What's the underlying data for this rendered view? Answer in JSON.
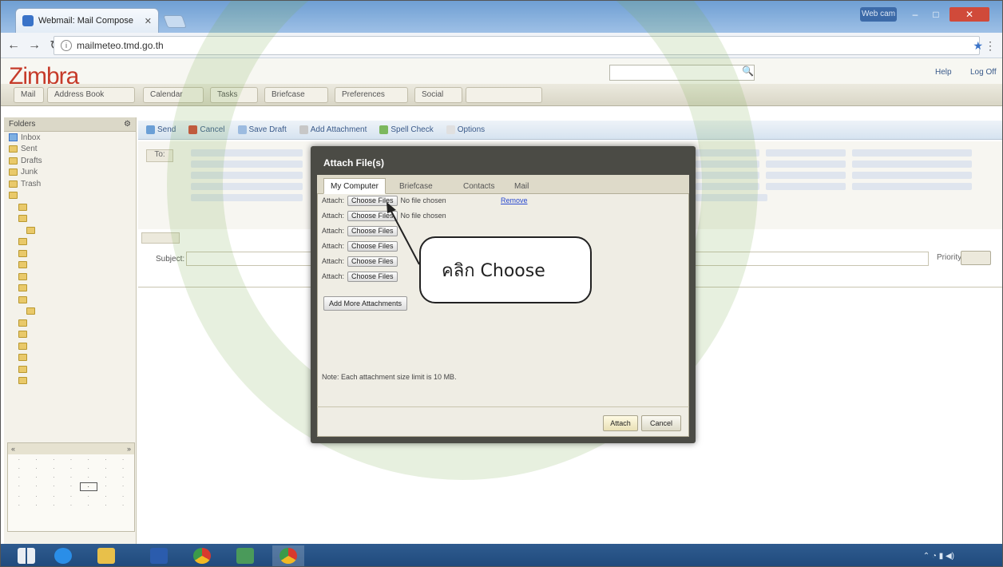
{
  "browser": {
    "tab_title": "Webmail: Mail Compose",
    "url": "mailmeteo.tmd.go.th",
    "user_badge": "Web cam"
  },
  "zimbra": {
    "logo": "Zimbra",
    "search_placeholder": "",
    "user_email": "",
    "help_label": "Help",
    "logoff_label": "Log Off",
    "app_tabs": [
      "Mail",
      "Address Book",
      "Calendar",
      "Tasks",
      "Briefcase",
      "Preferences",
      "Social",
      ""
    ]
  },
  "sidebar": {
    "header": "Folders",
    "folders": [
      {
        "label": "Inbox",
        "level": 0,
        "type": "inbox"
      },
      {
        "label": "Sent",
        "level": 0,
        "type": "folder"
      },
      {
        "label": "Drafts",
        "level": 0,
        "type": "folder"
      },
      {
        "label": "Junk",
        "level": 0,
        "type": "folder"
      },
      {
        "label": "Trash",
        "level": 0,
        "type": "folder"
      },
      {
        "label": "",
        "level": 0,
        "type": "folder"
      },
      {
        "label": "",
        "level": 1,
        "type": "folder"
      },
      {
        "label": "",
        "level": 1,
        "type": "folder"
      },
      {
        "label": "",
        "level": 2,
        "type": "folder"
      },
      {
        "label": "",
        "level": 1,
        "type": "folder"
      },
      {
        "label": "",
        "level": 1,
        "type": "folder"
      },
      {
        "label": "",
        "level": 1,
        "type": "folder"
      },
      {
        "label": "",
        "level": 1,
        "type": "folder"
      },
      {
        "label": "",
        "level": 1,
        "type": "folder"
      },
      {
        "label": "",
        "level": 1,
        "type": "folder"
      },
      {
        "label": "",
        "level": 2,
        "type": "folder"
      },
      {
        "label": "",
        "level": 1,
        "type": "folder"
      },
      {
        "label": "",
        "level": 1,
        "type": "folder"
      },
      {
        "label": "",
        "level": 1,
        "type": "folder"
      },
      {
        "label": "",
        "level": 1,
        "type": "folder"
      },
      {
        "label": "",
        "level": 1,
        "type": "folder"
      },
      {
        "label": "",
        "level": 1,
        "type": "folder"
      }
    ],
    "calendar": {
      "month": "",
      "days": [
        "",
        "",
        "",
        "",
        "",
        "",
        "",
        "",
        "",
        "",
        "",
        "",
        "",
        "",
        "",
        "",
        "",
        "",
        "",
        "",
        "",
        "",
        "",
        "",
        "",
        "",
        "",
        "",
        "",
        "",
        "",
        "",
        "",
        "",
        "",
        "",
        "",
        "",
        "",
        "",
        "",
        ""
      ]
    }
  },
  "compose": {
    "toolbar": [
      "Send",
      "Cancel",
      "Save Draft",
      "Add Attachment",
      "Spell Check",
      "Options"
    ],
    "to_label": "To:",
    "subject_label": "Subject:",
    "subject_value": "",
    "priority_label": "Priority:",
    "body_text": ""
  },
  "dialog": {
    "title": "Attach File(s)",
    "tabs": [
      "My Computer",
      "Briefcase",
      "Contacts",
      "Mail"
    ],
    "attach_label": "Attach:",
    "choose_button": "Choose Files",
    "no_file": "No file chosen",
    "remove_link": "Remove",
    "add_more": "Add More Attachments",
    "note": "Note: Each attachment size limit is 10 MB.",
    "attach_button": "Attach",
    "cancel_button": "Cancel"
  },
  "callout": {
    "text": "คลิก Choose"
  },
  "taskbar": {
    "clock_time": "",
    "clock_date": ""
  }
}
